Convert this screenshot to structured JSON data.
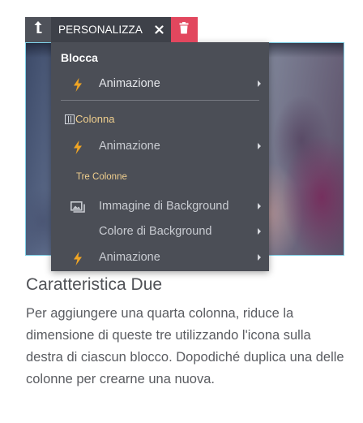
{
  "toolbar": {
    "title": "PERSONALIZZA",
    "icons": {
      "up": "arrow-up-icon",
      "close": "close-icon",
      "delete": "trash-icon"
    }
  },
  "menu": {
    "block_heading": "Blocca",
    "block_items": [
      {
        "label": "Animazione",
        "icon": "bolt-icon"
      }
    ],
    "column_section": "Colonna",
    "column_items": [
      {
        "label": "Animazione",
        "icon": "bolt-icon"
      }
    ],
    "sub_section": "Tre Colonne",
    "sub_items": [
      {
        "label": "Immagine di Background",
        "icon": "image-icon"
      },
      {
        "label": "Colore di Background",
        "icon": ""
      },
      {
        "label": "Animazione",
        "icon": "bolt-icon"
      }
    ]
  },
  "content": {
    "title": "Caratteristica Due",
    "body": "Per aggiungere una quarta colonna, riduce la dimensione di queste tre utilizzando l'icona sulla destra di ciascun blocco. Dopodiché duplica una delle colonne per crearne una nuova."
  },
  "colors": {
    "toolbar_bg": "#3e4149",
    "delete_bg": "#e2475e",
    "menu_bg": "#4b4e56",
    "accent_bolt": "#f0a524",
    "section_label": "#f0cf8e"
  }
}
